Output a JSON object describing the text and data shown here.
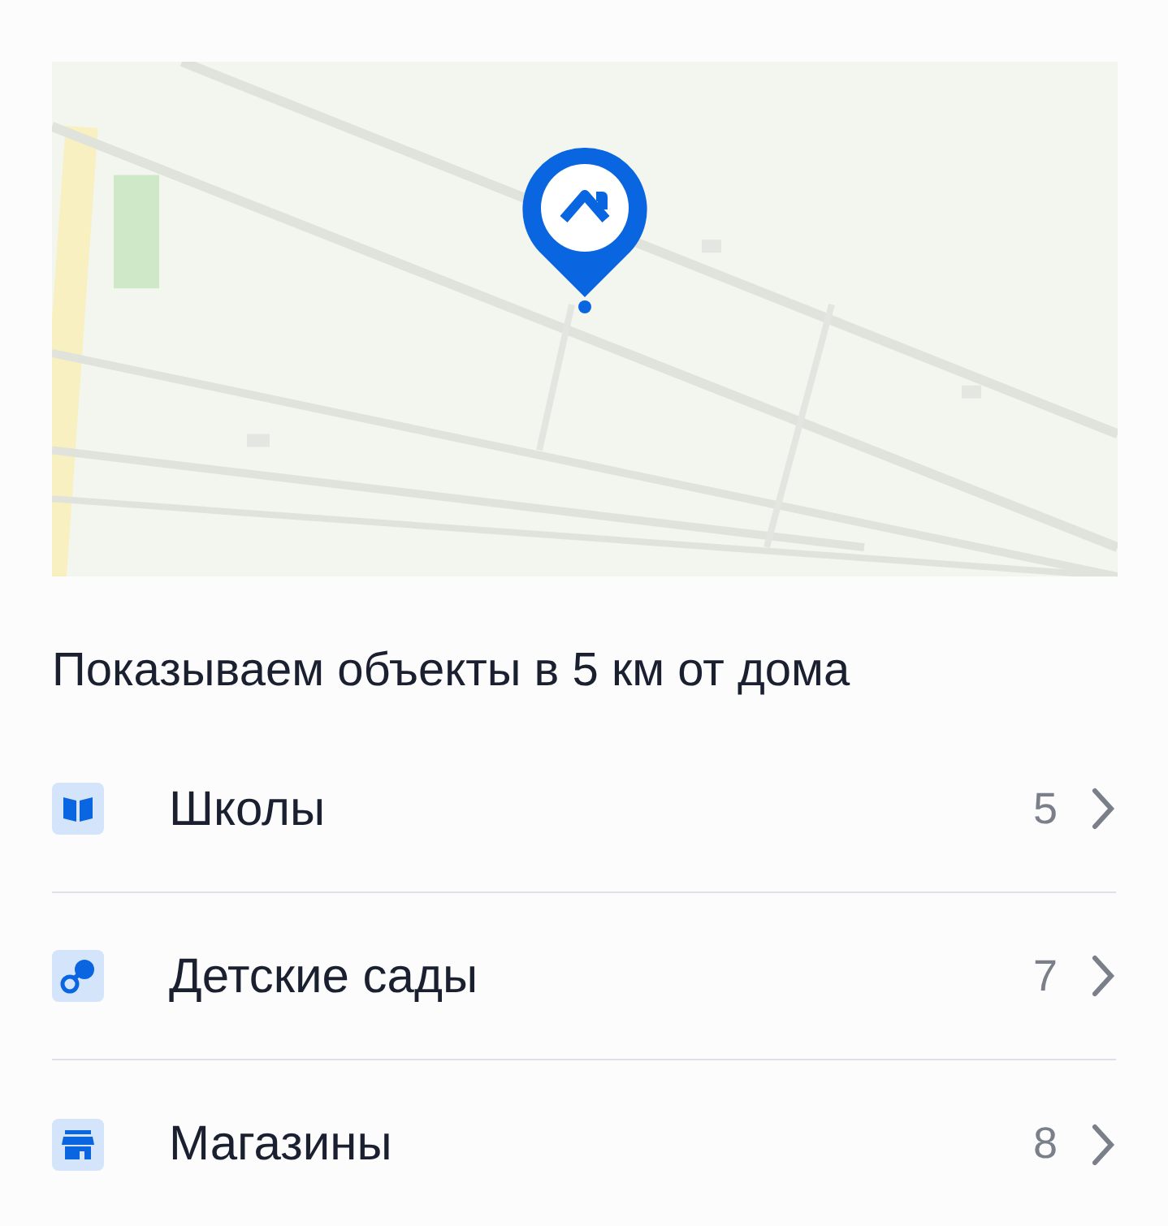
{
  "heading": "Показываем объекты в 5 км от дома",
  "categories": [
    {
      "kind": "school",
      "label": "Школы",
      "count": "5"
    },
    {
      "kind": "kindergarten",
      "label": "Детские сады",
      "count": "7"
    },
    {
      "kind": "shop",
      "label": "Магазины",
      "count": "8"
    }
  ]
}
